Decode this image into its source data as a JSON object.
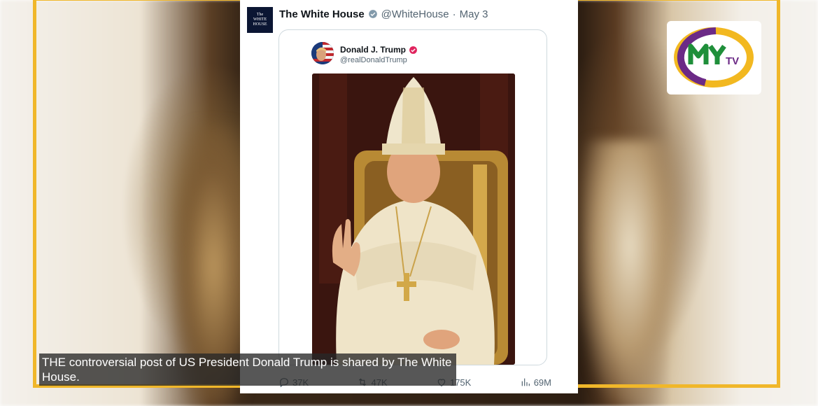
{
  "tweet": {
    "account_name": "The White House",
    "handle": "@WhiteHouse",
    "separator": "·",
    "date": "May 3",
    "avatar_text": [
      "The",
      "WHITE",
      "HOUSE"
    ],
    "quoted": {
      "account_name": "Donald J. Trump",
      "handle": "@realDonaldTrump"
    },
    "actions": [
      {
        "icon": "reply-icon",
        "count": "37K"
      },
      {
        "icon": "retweet-icon",
        "count": "47K"
      },
      {
        "icon": "like-icon",
        "count": "175K"
      },
      {
        "icon": "views-icon",
        "count": "69M"
      }
    ]
  },
  "logo": {
    "text": "MYTV",
    "colors": {
      "ring_purple": "#6b2a86",
      "ring_yellow": "#f2b820",
      "letters_green": "#1f8f3a"
    }
  },
  "caption": "THE controversial post of US President Donald Trump is shared by The White House.",
  "colors": {
    "frame": "#f0b72a",
    "verified_red": "#e0245e",
    "verified_gray": "#829aab"
  }
}
